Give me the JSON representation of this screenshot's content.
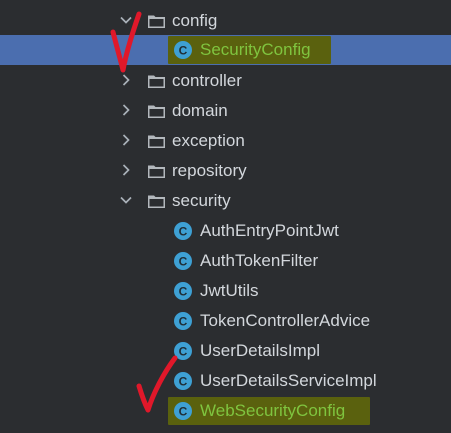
{
  "tree": {
    "top_fragment": "",
    "items": [
      {
        "label": "config",
        "type": "folder",
        "expanded": true
      },
      {
        "label": "SecurityConfig",
        "type": "class",
        "selected": true,
        "highlighted": true
      },
      {
        "label": "controller",
        "type": "folder",
        "expanded": false
      },
      {
        "label": "domain",
        "type": "folder",
        "expanded": false
      },
      {
        "label": "exception",
        "type": "folder",
        "expanded": false
      },
      {
        "label": "repository",
        "type": "folder",
        "expanded": false
      },
      {
        "label": "security",
        "type": "folder",
        "expanded": true
      },
      {
        "label": "AuthEntryPointJwt",
        "type": "class"
      },
      {
        "label": "AuthTokenFilter",
        "type": "class"
      },
      {
        "label": "JwtUtils",
        "type": "class"
      },
      {
        "label": "TokenControllerAdvice",
        "type": "class"
      },
      {
        "label": "UserDetailsImpl",
        "type": "class"
      },
      {
        "label": "UserDetailsServiceImpl",
        "type": "class"
      },
      {
        "label": "WebSecurityConfig",
        "type": "class",
        "highlighted": true
      }
    ]
  },
  "icons": {
    "class_letter": "C",
    "folder": "folder-icon",
    "class": "class-icon",
    "expanded": "chevron-down-icon",
    "collapsed": "chevron-right-icon"
  },
  "colors": {
    "background": "#2b2d30",
    "selection": "#4b6eaf",
    "class_icon": "#3ea0d4",
    "highlight": "#5a610e",
    "highlight_text": "#7fc43f",
    "check_mark": "#e0182a"
  },
  "annotations": [
    {
      "kind": "red-check-mark",
      "target": "SecurityConfig"
    },
    {
      "kind": "red-check-mark",
      "target": "WebSecurityConfig"
    }
  ]
}
